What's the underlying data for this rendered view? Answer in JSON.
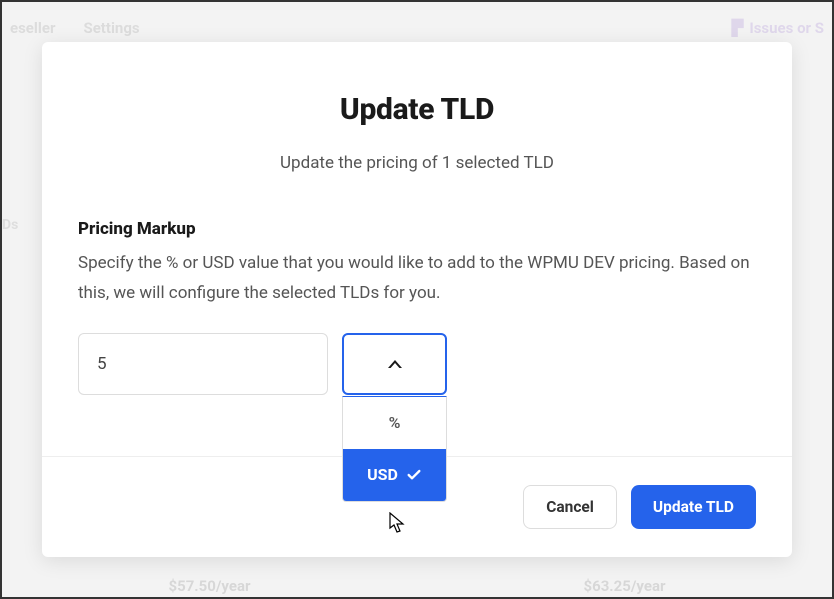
{
  "background": {
    "nav": {
      "left1": "eseller",
      "left2": "Settings",
      "right": "Issues or S"
    },
    "leftLabel": "Ds",
    "price1": "$57.50/year",
    "price2": "$63.25/year"
  },
  "modal": {
    "title": "Update TLD",
    "subtitle": "Update the pricing of 1 selected TLD",
    "section_label": "Pricing Markup",
    "section_desc": "Specify the % or USD value that you would like to add to the WPMU DEV pricing. Based on this, we will configure the selected TLDs for you.",
    "value": "5",
    "dropdown": {
      "option_percent": "%",
      "option_usd": "USD"
    },
    "cancel_label": "Cancel",
    "submit_label": "Update TLD"
  }
}
